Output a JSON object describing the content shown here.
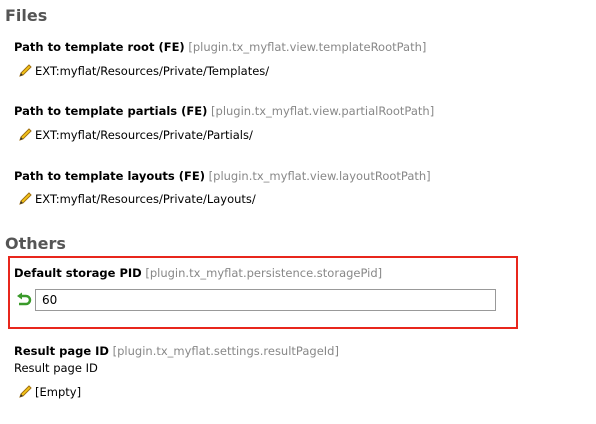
{
  "sections": [
    {
      "title": "Files",
      "items": [
        {
          "label": "Path to template root (FE)",
          "key": "[plugin.tx_myflat.view.templateRootPath]",
          "value": "EXT:myflat/Resources/Private/Templates/"
        },
        {
          "label": "Path to template partials (FE)",
          "key": "[plugin.tx_myflat.view.partialRootPath]",
          "value": "EXT:myflat/Resources/Private/Partials/"
        },
        {
          "label": "Path to template layouts (FE)",
          "key": "[plugin.tx_myflat.view.layoutRootPath]",
          "value": "EXT:myflat/Resources/Private/Layouts/"
        }
      ]
    },
    {
      "title": "Others",
      "items": [
        {
          "label": "Default storage PID",
          "key": "[plugin.tx_myflat.persistence.storagePid]",
          "value": "60"
        },
        {
          "label": "Result page ID",
          "key": "[plugin.tx_myflat.settings.resultPageId]",
          "description": "Result page ID",
          "value": "[Empty]"
        }
      ]
    }
  ],
  "highlight_color": "#e8261c"
}
